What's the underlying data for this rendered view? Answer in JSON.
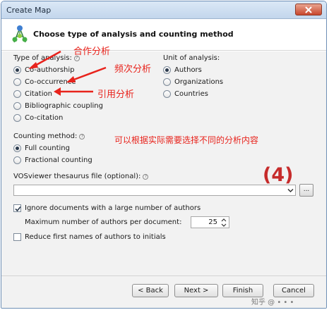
{
  "window": {
    "title": "Create Map",
    "close_icon": "close-icon"
  },
  "header": {
    "title": "Choose type of analysis and counting method",
    "icon": "vosviewer-map-icon"
  },
  "type_of_analysis": {
    "label": "Type of analysis:",
    "options": [
      {
        "label": "Co-authorship",
        "selected": true
      },
      {
        "label": "Co-occurrence",
        "selected": false
      },
      {
        "label": "Citation",
        "selected": false
      },
      {
        "label": "Bibliographic coupling",
        "selected": false
      },
      {
        "label": "Co-citation",
        "selected": false
      }
    ]
  },
  "unit_of_analysis": {
    "label": "Unit of analysis:",
    "options": [
      {
        "label": "Authors",
        "selected": true
      },
      {
        "label": "Organizations",
        "selected": false
      },
      {
        "label": "Countries",
        "selected": false
      }
    ]
  },
  "counting_method": {
    "label": "Counting method:",
    "options": [
      {
        "label": "Full counting",
        "selected": true
      },
      {
        "label": "Fractional counting",
        "selected": false
      }
    ]
  },
  "thesaurus": {
    "label": "VOSviewer thesaurus file (optional):",
    "value": "",
    "browse_label": "..."
  },
  "ignore_documents": {
    "label": "Ignore documents with a large number of authors",
    "checked": true,
    "max_authors_label": "Maximum number of authors per document:",
    "max_authors_value": "25"
  },
  "reduce_first_names": {
    "label": "Reduce first names of authors to initials",
    "checked": false
  },
  "buttons": {
    "back": "< Back",
    "next": "Next >",
    "finish": "Finish",
    "cancel": "Cancel"
  },
  "annotations": {
    "coauthorship": "合作分析",
    "cooccurrence": "频次分析",
    "citation": "引用分析",
    "note": "可以根据实际需要选择不同的分析内容",
    "step": "(4)",
    "arrow_color": "#e8231c"
  },
  "watermark": "知乎 @ • • •"
}
